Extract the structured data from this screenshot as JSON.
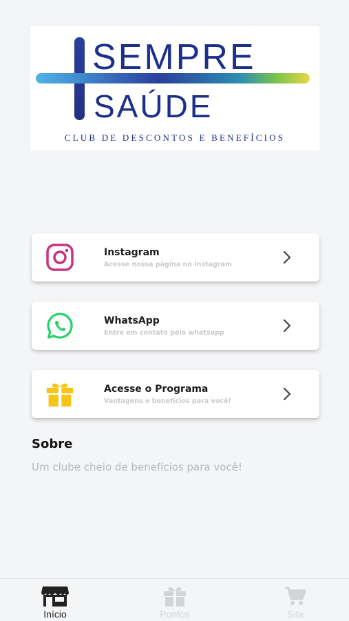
{
  "brand": {
    "line1": "SEMPRE",
    "line2": "SAÚDE",
    "tagline": "CLUB DE DESCONTOS E BENEFÍCIOS"
  },
  "cards": [
    {
      "title": "Instagram",
      "subtitle": "Acesse nossa página no Instagram",
      "icon": "instagram-icon"
    },
    {
      "title": "WhatsApp",
      "subtitle": "Entre em contato pelo whatsapp",
      "icon": "whatsapp-icon"
    },
    {
      "title": "Acesse o Programa",
      "subtitle": "Vantagens e benefícios para você!",
      "icon": "gift-icon"
    }
  ],
  "about": {
    "title": "Sobre",
    "text": "Um clube cheio de benefícios para você!"
  },
  "nav": [
    {
      "label": "Início",
      "icon": "store-icon",
      "active": true
    },
    {
      "label": "Pontos",
      "icon": "gift-icon",
      "active": false
    },
    {
      "label": "Site",
      "icon": "cart-icon",
      "active": false
    }
  ],
  "colors": {
    "brand_blue": "#1c2f8a",
    "instagram": "#c8327f",
    "whatsapp": "#25d366",
    "gift": "#f5c518",
    "nav_active": "#222222",
    "nav_inactive": "#d3d4d6"
  }
}
